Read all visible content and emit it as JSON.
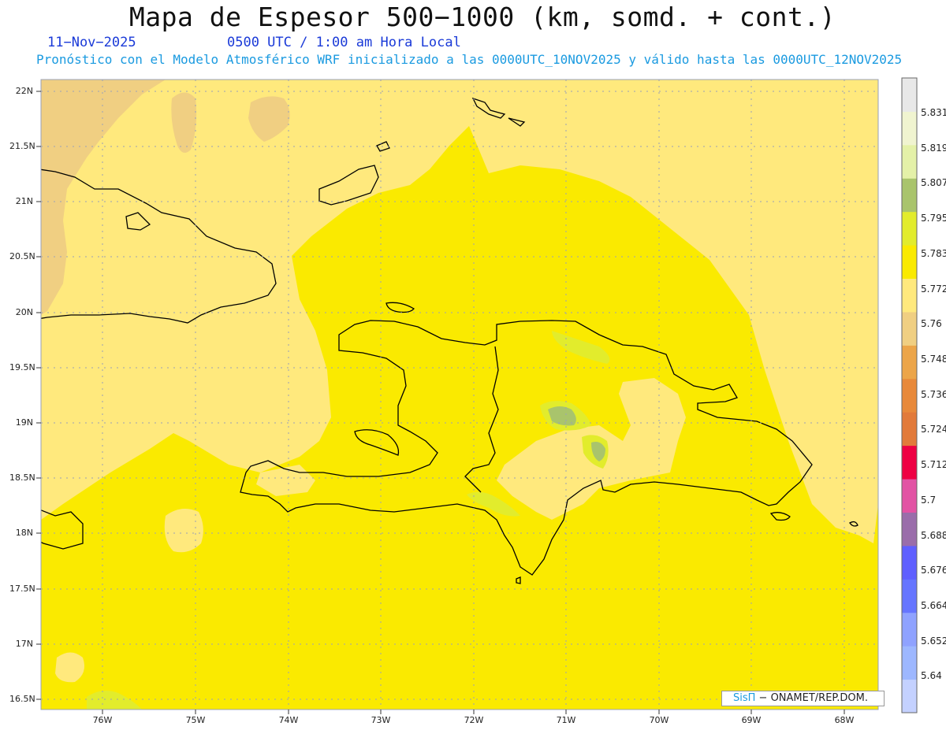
{
  "header": {
    "title": "Mapa de Espesor 500−1000 (km, somd. + cont.)",
    "date": "11−Nov−2025",
    "time": "0500 UTC / 1:00 am Hora Local",
    "forecast_info": "Pronóstico con el Modelo Atmosférico WRF inicializado a las 0000UTC_10NOV2025 y válido hasta las  0000UTC_12NOV2025"
  },
  "map": {
    "lat_labels": [
      "22N",
      "21.5N",
      "21N",
      "20.5N",
      "20N",
      "19.5N",
      "19N",
      "18.5N",
      "18N",
      "17.5N",
      "17N",
      "16.5N"
    ],
    "lon_labels": [
      "76W",
      "75W",
      "74W",
      "73W",
      "72W",
      "71W",
      "70W",
      "69W",
      "68W"
    ],
    "colors": {
      "band_5748_5760": "#F0CF82",
      "band_5760_5772": "#FFE97D",
      "band_5772_5783": "#FAEA00",
      "band_5783_5795": "#E2EC2C",
      "band_5795_5807": "#A9C46C"
    }
  },
  "colorbar": {
    "levels": [
      "5.64",
      "5.652",
      "5.664",
      "5.676",
      "5.688",
      "5.7",
      "5.712",
      "5.724",
      "5.736",
      "5.748",
      "5.76",
      "5.772",
      "5.783",
      "5.795",
      "5.807",
      "5.819",
      "5.831"
    ],
    "colors": [
      "#C4D1FF",
      "#9DB7FF",
      "#8FA2FF",
      "#6675FF",
      "#5F5FFF",
      "#9A6DAA",
      "#E253A4",
      "#EE0043",
      "#E27A3A",
      "#E8893A",
      "#ECA549",
      "#F0CF82",
      "#FFE97D",
      "#FAEA00",
      "#E2EC2C",
      "#A9C46C",
      "#E4F1A8",
      "#F0F4D0",
      "#E8E8E8"
    ]
  },
  "credit": {
    "brand": "SisΠ",
    "text": " − ONAMET/REP.DOM."
  }
}
